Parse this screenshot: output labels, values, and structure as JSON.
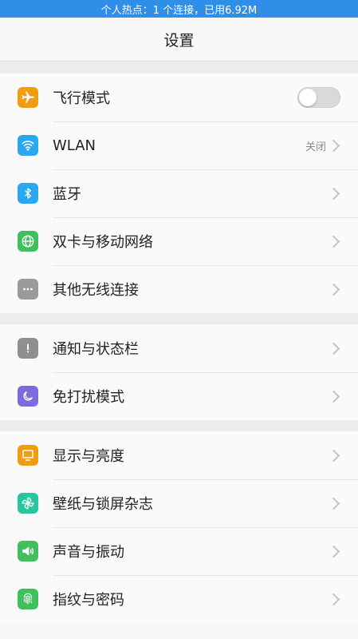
{
  "status_bar": {
    "text": "个人热点：1 个连接，已用6.92M"
  },
  "header": {
    "title": "设置"
  },
  "groups": [
    {
      "items": [
        {
          "label": "飞行模式",
          "icon": "airplane-icon",
          "color": "#f39c12",
          "control": "toggle",
          "toggle_on": false
        },
        {
          "label": "WLAN",
          "icon": "wifi-icon",
          "color": "#29a8f0",
          "control": "chevron",
          "value": "关闭"
        },
        {
          "label": "蓝牙",
          "icon": "bluetooth-icon",
          "color": "#29a8f0",
          "control": "chevron"
        },
        {
          "label": "双卡与移动网络",
          "icon": "globe-icon",
          "color": "#3fbf5e",
          "control": "chevron"
        },
        {
          "label": "其他无线连接",
          "icon": "more-dots-icon",
          "color": "#9a9a9a",
          "control": "chevron"
        }
      ]
    },
    {
      "items": [
        {
          "label": "通知与状态栏",
          "icon": "exclamation-icon",
          "color": "#8f8f8f",
          "control": "chevron"
        },
        {
          "label": "免打扰模式",
          "icon": "moon-icon",
          "color": "#7c6bde",
          "control": "chevron"
        }
      ]
    },
    {
      "items": [
        {
          "label": "显示与亮度",
          "icon": "display-icon",
          "color": "#f39c12",
          "control": "chevron"
        },
        {
          "label": "壁纸与锁屏杂志",
          "icon": "pinwheel-icon",
          "color": "#26c6a0",
          "control": "chevron"
        },
        {
          "label": "声音与振动",
          "icon": "speaker-icon",
          "color": "#3fbf5e",
          "control": "chevron"
        },
        {
          "label": "指纹与密码",
          "icon": "fingerprint-icon",
          "color": "#3fbf5e",
          "control": "chevron"
        }
      ]
    }
  ]
}
